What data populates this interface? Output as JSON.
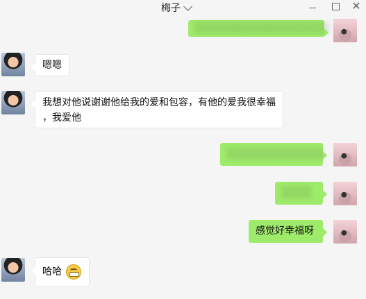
{
  "window": {
    "contact_name": "梅子",
    "controls": {
      "minimize": "—",
      "maximize": "□",
      "close": "✕"
    }
  },
  "messages": [
    {
      "side": "out",
      "text": "░░░░░░░░░░░░░░░░░░",
      "blurred": true
    },
    {
      "side": "in",
      "text": "嗯嗯"
    },
    {
      "side": "in",
      "text_line1": "我想对他说谢谢他给我的爱和包容，有他的爱我很幸福",
      "text_line2": "，我爱他"
    },
    {
      "side": "out",
      "text": "░░░░░░░░░░░░░",
      "blurred": true
    },
    {
      "side": "out",
      "text": "░░░░",
      "blurred": true
    },
    {
      "side": "out",
      "text": "感觉好幸福呀"
    },
    {
      "side": "in",
      "text": "哈哈",
      "emoji": "grinning-face-emoji"
    }
  ],
  "colors": {
    "background": "#f5f5f5",
    "outgoing_bubble": "#9eea6a",
    "incoming_bubble": "#ffffff"
  }
}
